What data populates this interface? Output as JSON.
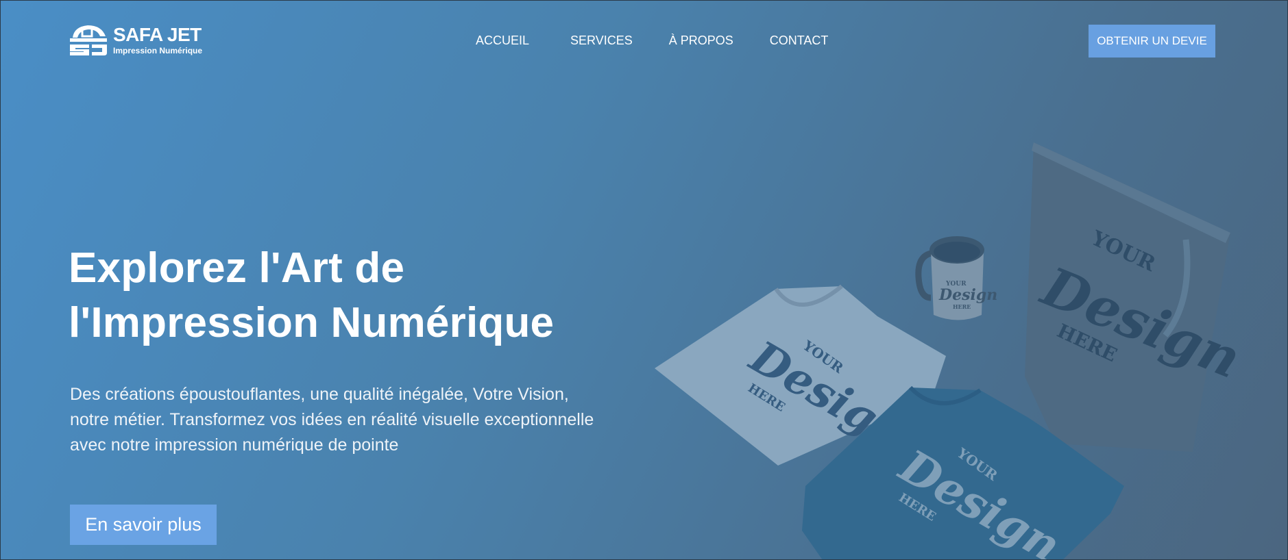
{
  "header": {
    "logo": {
      "name": "SAFA JET",
      "tagline": "Impression Numérique",
      "mark_icon": "sj-logo-icon"
    },
    "nav": [
      {
        "label": "ACCUEIL"
      },
      {
        "label": "SERVICES"
      },
      {
        "label": "À PROPOS"
      },
      {
        "label": "CONTACT"
      }
    ],
    "cta_label": "OBTENIR UN DEVIE"
  },
  "hero": {
    "title_line1": "Explorez l'Art de",
    "title_line2": "l'Impression Numérique",
    "description": "Des créations époustouflantes, une qualité inégalée, Votre Vision, notre métier. Transformez vos idées en réalité visuelle exceptionnelle avec notre impression numérique de pointe",
    "button_label": "En savoir plus"
  },
  "mockup": {
    "print_top": "YOUR",
    "print_main": "Design",
    "print_bottom": "HERE"
  },
  "colors": {
    "accent": "#68a0e1",
    "background_left": "#4a8ec6",
    "background_right": "#4b6680"
  }
}
